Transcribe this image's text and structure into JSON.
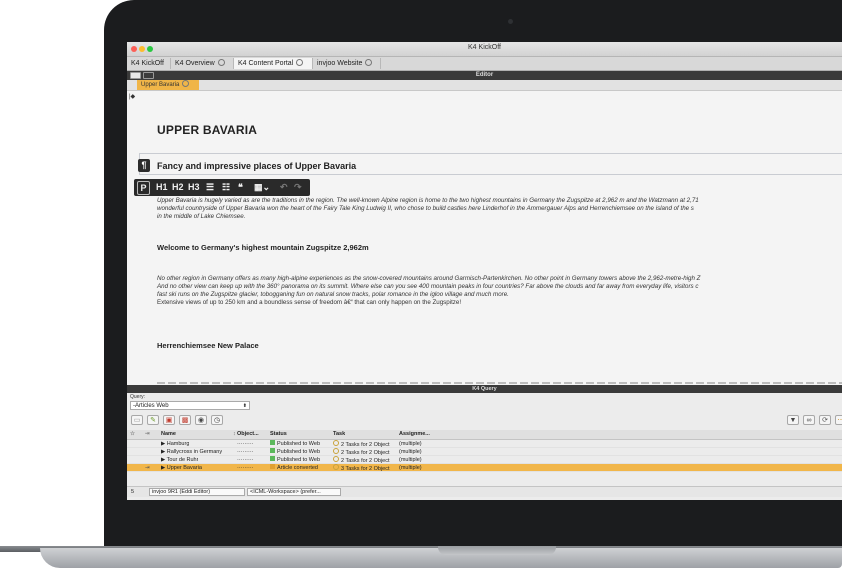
{
  "window": {
    "title": "K4 KickOff"
  },
  "tabs": [
    {
      "label": "K4 KickOff"
    },
    {
      "label": "K4 Overview"
    },
    {
      "label": "K4 Content Portal"
    },
    {
      "label": "invjoo Website"
    }
  ],
  "editor": {
    "bar_title": "Editor",
    "doc_tab": "Upper Bavaria",
    "heading": "UPPER BAVARIA",
    "subheading": "Fancy and impressive places of Upper Bavaria",
    "toolbar": {
      "p": "P",
      "h1": "H1",
      "h2": "H2",
      "h3": "H3",
      "quote": "❝",
      "undo": "↶",
      "redo": "↷"
    },
    "intro_lines": [
      "Upper Bavaria is hugely varied as are the traditions in the region. The well-known Alpine region is home to the two highest mountains in Germany the Zugspitze at 2,962 m and the Watzmann at 2,71",
      "wonderful countryside of Upper Bavaria won the heart of the Fairy Tale King Ludwig II, who chose to build castles here Linderhof in the Ammergauer Alps and Herrenchiemsee on the island of the s",
      "in the middle of Lake Chiemsee."
    ],
    "section1_heading": "Welcome to Germany's highest mountain Zugspitze 2,962m",
    "section1_lines": [
      "No other region in Germany offers as many high-alpine experiences as the snow-covered mountains around Garmisch-Partenkirchen. No other point in Germany towers above the 2,962-metre-high Z",
      "And no other view can keep up with the 360° panorama on its summit. Where else can you see 400 mountain peaks in four countries? Far above the clouds and far away from everyday life, visitors c",
      "fast ski runs on the Zugspitze glacier, tobogganing fun on natural snow tracks, polar romance in the igloo village and much more.",
      "Extensive views of up to 250 km and a boundless sense of freedom â€“ that can only happen on the Zugspitze!"
    ],
    "section2_heading": "Herrenchiemsee New Palace"
  },
  "query": {
    "bar_title": "K4 Query",
    "label": "Query:",
    "selected": "-Articles Web",
    "columns": [
      "Name",
      "Object...",
      "Status",
      "Task",
      "Assignme..."
    ],
    "rows": [
      {
        "name": "▶ Hamburg",
        "object": "·········",
        "status": "Published to Web",
        "status_color": "#5cb85c",
        "task": "2 Tasks for 2 Object",
        "assignee": "(multiple)"
      },
      {
        "name": "▶ Rallycross in Germany",
        "object": "·········",
        "status": "Published to Web",
        "status_color": "#5cb85c",
        "task": "2 Tasks for 2 Object",
        "assignee": "(multiple)"
      },
      {
        "name": "▶ Tour de Ruhr",
        "object": "·········",
        "status": "Published to Web",
        "status_color": "#5cb85c",
        "task": "2 Tasks for 2 Object",
        "assignee": "(multiple)"
      },
      {
        "name": "▶ Upper Bavaria",
        "object": "·········",
        "status": "Article converted",
        "status_color": "#e0a030",
        "task": "3 Tasks for 2 Object",
        "assignee": "(multiple)"
      }
    ],
    "status": {
      "count": "5",
      "workspace": "invjoo 9R1 (Eddi Editor)",
      "layout": "<ICML-Workspace> (prefer..."
    }
  },
  "colors": {
    "accent": "#f0b548",
    "dark_bar": "#3a3a3a"
  }
}
